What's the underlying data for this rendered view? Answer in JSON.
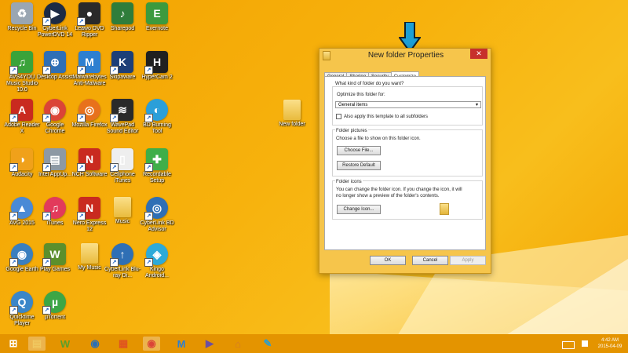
{
  "desktop": {
    "icons": [
      {
        "label": "Recycle Bin",
        "icon": "recycle-bin-icon",
        "color": "#9aa6b2"
      },
      {
        "label": "CyberLink PowerDVD 14",
        "icon": "powerdvd-icon",
        "color": "#1d2b45"
      },
      {
        "label": "Leawo DVD Ripper",
        "icon": "leawo-dvd-ripper-icon",
        "color": "#2a2a2a"
      },
      {
        "label": "Sharepod",
        "icon": "sharepod-icon",
        "color": "#2f7d3b"
      },
      {
        "label": "Evernote",
        "icon": "evernote-icon",
        "color": "#3c9a3e"
      },
      {
        "label": "AVS4YOU Music Studio 10.0",
        "icon": "avs-music-icon",
        "color": "#3aa33a"
      },
      {
        "label": "Desktop Assist",
        "icon": "desktop-assist-icon",
        "color": "#2f6fb5"
      },
      {
        "label": "Malwarebytes Anti-Malware",
        "icon": "malwarebytes-icon",
        "color": "#2d7fd0"
      },
      {
        "label": "Skipaware",
        "icon": "skipaware-icon",
        "color": "#1d3f78"
      },
      {
        "label": "HyperCam 2",
        "icon": "hypercam-icon",
        "color": "#202020"
      },
      {
        "label": "Adobe Reader X",
        "icon": "adobe-reader-icon",
        "color": "#c92a1f"
      },
      {
        "label": "Google Chrome",
        "icon": "chrome-icon",
        "color": "#db4437"
      },
      {
        "label": "Mozilla Firefox",
        "icon": "firefox-icon",
        "color": "#e8711c"
      },
      {
        "label": "WavePad Sound Editor",
        "icon": "wavepad-icon",
        "color": "#2a2a2a"
      },
      {
        "label": "BD Burning Tool",
        "icon": "bd-burning-icon",
        "color": "#2b9fd9"
      },
      {
        "label": "Audacity",
        "icon": "audacity-icon",
        "color": "#f0a11a"
      },
      {
        "label": "Intel AppUp...",
        "icon": "intel-appup-icon",
        "color": "#8d99a4"
      },
      {
        "label": "NCH Software",
        "icon": "nch-software-icon",
        "color": "#c92a1f"
      },
      {
        "label": "Cellphone iTunes",
        "icon": "cellphone-icon",
        "color": "#eeeeee"
      },
      {
        "label": "Recordable Setup",
        "icon": "recordable-setup-icon",
        "color": "#3fae49"
      },
      {
        "label": "AVG 2015",
        "icon": "avg-icon",
        "color": "#4a8ad6"
      },
      {
        "label": "iTunes",
        "icon": "itunes-icon",
        "color": "#e23a5b"
      },
      {
        "label": "Nero Express 12",
        "icon": "nero-icon",
        "color": "#c92a1f"
      },
      {
        "label": "Music",
        "icon": "folder-icon",
        "color": "#f0c860"
      },
      {
        "label": "CyberLink BD Advisor",
        "icon": "bd-advisor-icon",
        "color": "#2f6fb5"
      },
      {
        "label": "Google Earth",
        "icon": "google-earth-icon",
        "color": "#3a7fbf"
      },
      {
        "label": "Play Games",
        "icon": "play-games-icon",
        "color": "#5c8f2c"
      },
      {
        "label": "My Music",
        "icon": "folder-icon",
        "color": "#f0c860"
      },
      {
        "label": "CyberLink Blu-ray Di...",
        "icon": "bluray-icon",
        "color": "#2f6fb5"
      },
      {
        "label": "Kingo Android...",
        "icon": "kingo-icon",
        "color": "#2eaad8"
      },
      {
        "label": "Quicktime Player",
        "icon": "quicktime-icon",
        "color": "#3a86c8"
      },
      {
        "label": "µTorrent",
        "icon": "utorrent-icon",
        "color": "#3da645"
      }
    ],
    "new_folder": {
      "label": "New folder",
      "icon": "folder-icon"
    }
  },
  "dialog": {
    "title": "New folder Properties",
    "close_symbol": "✕",
    "tabs": [
      "General",
      "Sharing",
      "Security",
      "Customize"
    ],
    "active_tab": "Customize",
    "question": "What kind of folder do you want?",
    "optimize_label": "Optimize this folder for:",
    "optimize_value": "General items",
    "subfolders_checkbox": "Also apply this template to all subfolders",
    "subfolders_checked": false,
    "pictures_heading": "Folder pictures",
    "pictures_text": "Choose a file to show on this folder icon.",
    "choose_file": "Choose File...",
    "restore_default": "Restore Default",
    "icons_heading": "Folder icons",
    "icons_text_1": "You can change the folder icon. If you change the icon, it will",
    "icons_text_2": "no longer show a preview of the folder's contents.",
    "change_icon": "Change Icon...",
    "ok": "OK",
    "cancel": "Cancel",
    "apply": "Apply"
  },
  "annotation": {
    "icon": "down-arrow-annotation-icon",
    "color": "#1c9fd6"
  },
  "taskbar": {
    "items": [
      {
        "icon": "windows-start-icon",
        "active": false
      },
      {
        "icon": "file-explorer-icon",
        "active": true
      },
      {
        "icon": "w-app-icon",
        "active": false
      },
      {
        "icon": "media-app-icon",
        "active": false
      },
      {
        "icon": "store-icon",
        "active": false
      },
      {
        "icon": "chrome-icon",
        "active": true
      },
      {
        "icon": "malwarebytes-icon",
        "active": false
      },
      {
        "icon": "video-app-icon",
        "active": false
      },
      {
        "icon": "game-icon",
        "active": false
      },
      {
        "icon": "paint-icon",
        "active": false
      }
    ],
    "time": "4:42 AM",
    "date": "2015-04-09",
    "color": "#e49400"
  }
}
